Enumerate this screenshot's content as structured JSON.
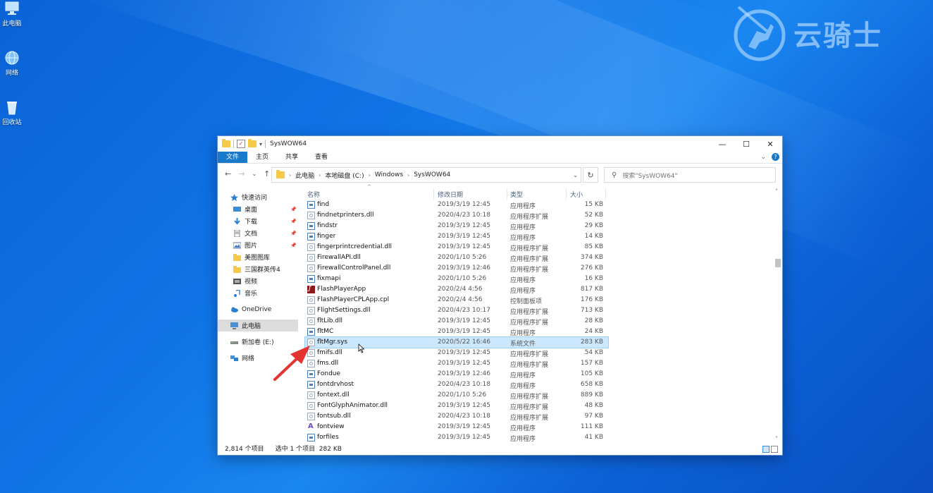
{
  "desktop": {
    "icons": [
      {
        "label": "此电脑",
        "icon": "computer-icon"
      },
      {
        "label": "网络",
        "icon": "network-icon"
      },
      {
        "label": "回收站",
        "icon": "recycle-bin-icon"
      }
    ],
    "watermark_text": "云骑士"
  },
  "window": {
    "title": "SysWOW64",
    "controls": {
      "minimize": "—",
      "maximize": "☐",
      "close": "✕"
    },
    "ribbon_tabs": [
      "文件",
      "主页",
      "共享",
      "查看"
    ],
    "address": {
      "crumbs": [
        "此电脑",
        "本地磁盘 (C:)",
        "Windows",
        "SysWOW64"
      ]
    },
    "search_placeholder": "搜索\"SysWOW64\"",
    "nav_pane": [
      {
        "label": "快速访问",
        "icon": "star-icon",
        "pinned": false,
        "level": 0
      },
      {
        "label": "桌面",
        "icon": "desktop-icon",
        "pinned": true,
        "level": 1
      },
      {
        "label": "下载",
        "icon": "download-icon",
        "pinned": true,
        "level": 1
      },
      {
        "label": "文档",
        "icon": "document-icon",
        "pinned": true,
        "level": 1
      },
      {
        "label": "图片",
        "icon": "picture-icon",
        "pinned": true,
        "level": 1
      },
      {
        "label": "美图图库",
        "icon": "folder-icon",
        "pinned": false,
        "level": 1
      },
      {
        "label": "三国群英传4",
        "icon": "folder-icon",
        "pinned": false,
        "level": 1
      },
      {
        "label": "视频",
        "icon": "video-icon",
        "pinned": false,
        "level": 1
      },
      {
        "label": "音乐",
        "icon": "music-icon",
        "pinned": false,
        "level": 1
      },
      {
        "label": "OneDrive",
        "icon": "cloud-icon",
        "pinned": false,
        "level": 0
      },
      {
        "label": "此电脑",
        "icon": "computer-icon",
        "pinned": false,
        "level": 0,
        "selected": true
      },
      {
        "label": "新加卷 (E:)",
        "icon": "drive-icon",
        "pinned": false,
        "level": 0
      },
      {
        "label": "网络",
        "icon": "network-icon",
        "pinned": false,
        "level": 0
      }
    ],
    "columns": {
      "name": "名称",
      "date": "修改日期",
      "type": "类型",
      "size": "大小"
    },
    "files": [
      {
        "name": "find",
        "date": "2019/3/19 12:45",
        "type": "应用程序",
        "size": "15 KB",
        "icon": "app"
      },
      {
        "name": "findnetprinters.dll",
        "date": "2020/4/23 10:18",
        "type": "应用程序扩展",
        "size": "52 KB",
        "icon": "dll"
      },
      {
        "name": "findstr",
        "date": "2019/3/19 12:45",
        "type": "应用程序",
        "size": "29 KB",
        "icon": "app"
      },
      {
        "name": "finger",
        "date": "2019/3/19 12:45",
        "type": "应用程序",
        "size": "14 KB",
        "icon": "app"
      },
      {
        "name": "fingerprintcredential.dll",
        "date": "2019/3/19 12:45",
        "type": "应用程序扩展",
        "size": "85 KB",
        "icon": "dll"
      },
      {
        "name": "FirewallAPI.dll",
        "date": "2020/1/10 5:26",
        "type": "应用程序扩展",
        "size": "374 KB",
        "icon": "dll"
      },
      {
        "name": "FirewallControlPanel.dll",
        "date": "2019/3/19 12:46",
        "type": "应用程序扩展",
        "size": "276 KB",
        "icon": "dll"
      },
      {
        "name": "fixmapi",
        "date": "2020/1/10 5:26",
        "type": "应用程序",
        "size": "16 KB",
        "icon": "app"
      },
      {
        "name": "FlashPlayerApp",
        "date": "2020/2/4 4:56",
        "type": "应用程序",
        "size": "817 KB",
        "icon": "flash"
      },
      {
        "name": "FlashPlayerCPLApp.cpl",
        "date": "2020/2/4 4:56",
        "type": "控制面板项",
        "size": "176 KB",
        "icon": "dll"
      },
      {
        "name": "FlightSettings.dll",
        "date": "2020/4/23 10:17",
        "type": "应用程序扩展",
        "size": "713 KB",
        "icon": "dll"
      },
      {
        "name": "fltLib.dll",
        "date": "2019/3/19 12:45",
        "type": "应用程序扩展",
        "size": "28 KB",
        "icon": "dll"
      },
      {
        "name": "fltMC",
        "date": "2019/3/19 12:45",
        "type": "应用程序",
        "size": "24 KB",
        "icon": "app"
      },
      {
        "name": "fltMgr.sys",
        "date": "2020/5/22 16:46",
        "type": "系统文件",
        "size": "283 KB",
        "icon": "dll",
        "selected": true
      },
      {
        "name": "fmifs.dll",
        "date": "2019/3/19 12:45",
        "type": "应用程序扩展",
        "size": "54 KB",
        "icon": "dll"
      },
      {
        "name": "fms.dll",
        "date": "2019/3/19 12:45",
        "type": "应用程序扩展",
        "size": "157 KB",
        "icon": "dll"
      },
      {
        "name": "Fondue",
        "date": "2019/3/19 12:46",
        "type": "应用程序",
        "size": "105 KB",
        "icon": "app"
      },
      {
        "name": "fontdrvhost",
        "date": "2020/4/23 10:18",
        "type": "应用程序",
        "size": "658 KB",
        "icon": "app"
      },
      {
        "name": "fontext.dll",
        "date": "2020/1/10 5:26",
        "type": "应用程序扩展",
        "size": "889 KB",
        "icon": "dll"
      },
      {
        "name": "FontGlyphAnimator.dll",
        "date": "2019/3/19 12:45",
        "type": "应用程序扩展",
        "size": "48 KB",
        "icon": "dll"
      },
      {
        "name": "fontsub.dll",
        "date": "2020/4/23 10:18",
        "type": "应用程序扩展",
        "size": "97 KB",
        "icon": "dll"
      },
      {
        "name": "fontview",
        "date": "2019/3/19 12:45",
        "type": "应用程序",
        "size": "111 KB",
        "icon": "font"
      },
      {
        "name": "forfiles",
        "date": "2019/3/19 12:45",
        "type": "应用程序",
        "size": "41 KB",
        "icon": "app"
      }
    ],
    "status": {
      "count": "2,814 个项目",
      "selection": "选中 1 个项目  282 KB"
    }
  },
  "colors": {
    "file_tab": "#1979ca",
    "selection": "#cce8ff",
    "desktop": "#0f73e6"
  }
}
